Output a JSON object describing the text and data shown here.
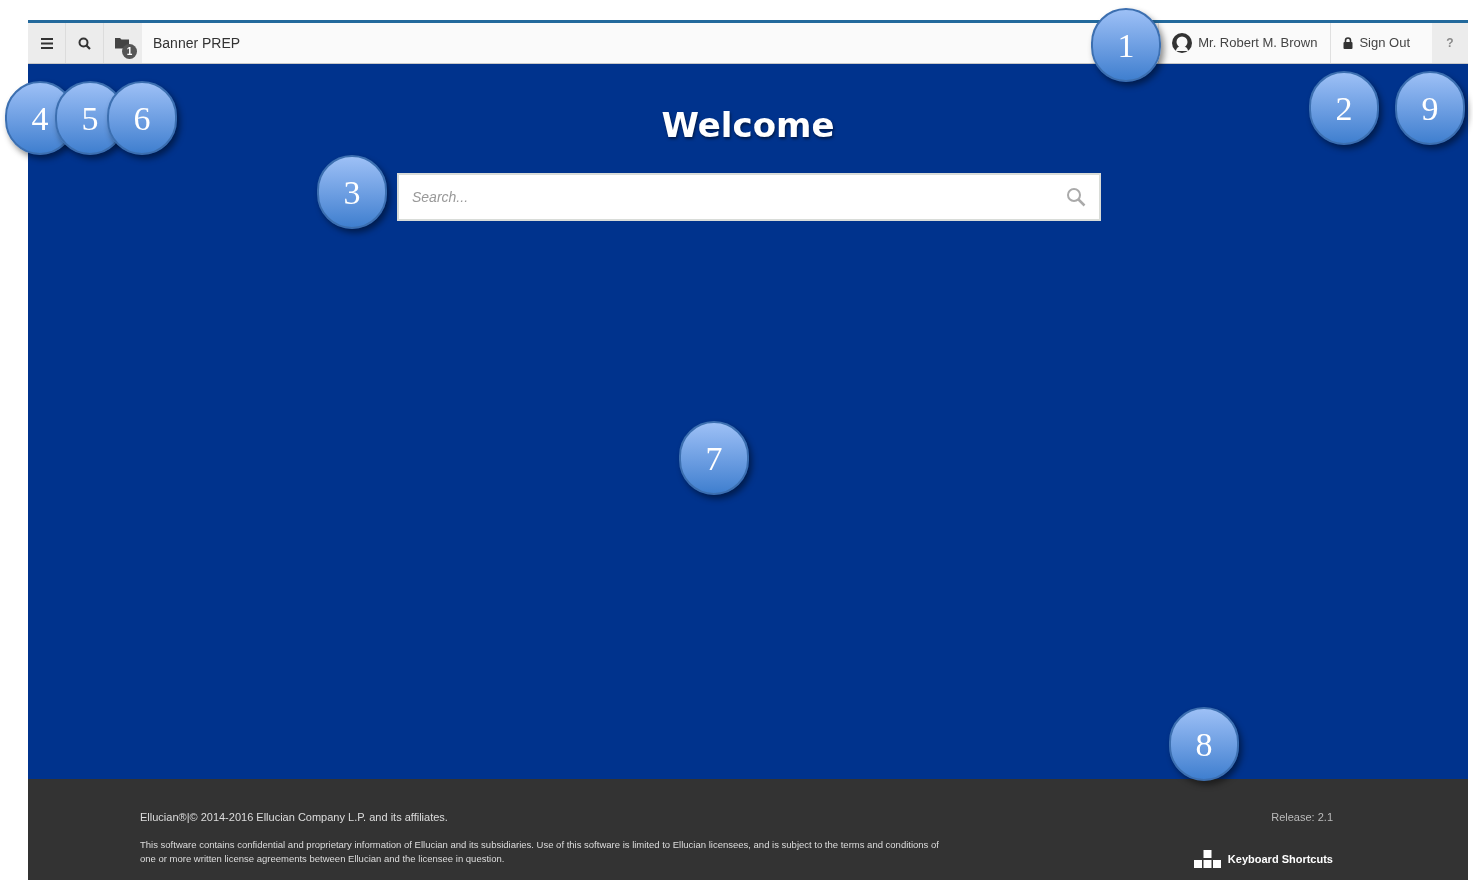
{
  "header": {
    "app_title": "Banner PREP",
    "recent_count": "1",
    "user_name": "Mr. Robert M. Brown",
    "sign_out": "Sign Out",
    "help": "?"
  },
  "main": {
    "title": "Welcome",
    "search": {
      "placeholder": "Search..."
    }
  },
  "footer": {
    "copyright": "Ellucian®|© 2014-2016 Ellucian Company L.P. and its affiliates.",
    "notice": "This software contains confidential and proprietary information of Ellucian and its subsidiaries. Use of this software is limited to Ellucian licensees, and is subject to the terms and conditions of one or more written license agreements between Ellucian and the licensee in question.",
    "release": "Release: 2.1",
    "shortcuts": "Keyboard Shortcuts"
  },
  "callouts": [
    "1",
    "2",
    "9",
    "4",
    "5",
    "6",
    "3",
    "7",
    "8"
  ]
}
